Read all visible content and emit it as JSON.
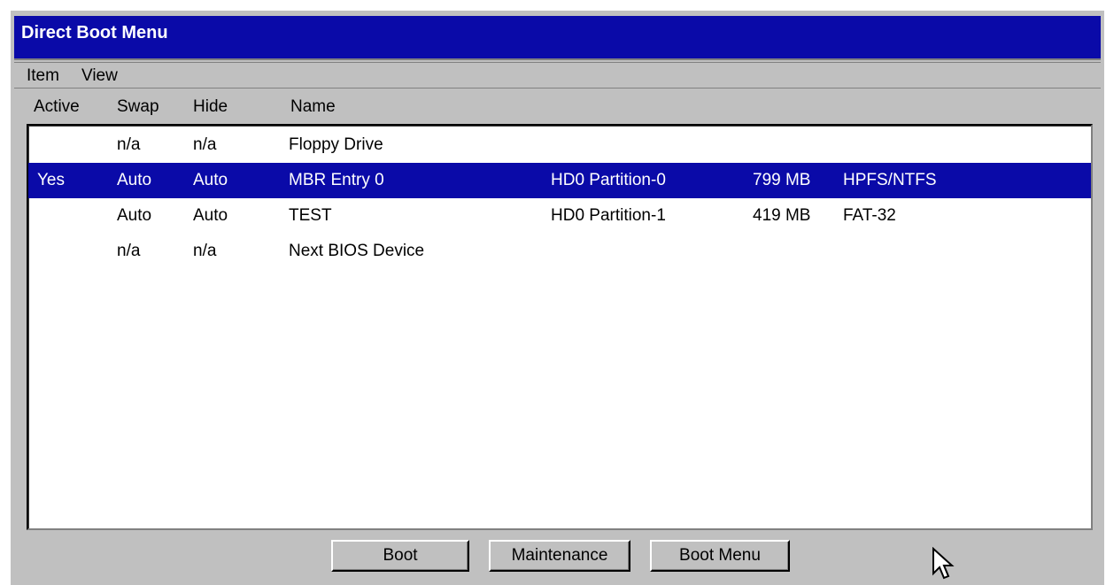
{
  "window": {
    "title": "Direct Boot Menu"
  },
  "menu": {
    "item": "Item",
    "view": "View"
  },
  "columns": {
    "active": "Active",
    "swap": "Swap",
    "hide": "Hide",
    "name": "Name"
  },
  "rows": [
    {
      "active": "",
      "swap": "n/a",
      "hide": "n/a",
      "name": "Floppy Drive",
      "location": "",
      "size": "",
      "fs": "",
      "selected": false
    },
    {
      "active": "Yes",
      "swap": "Auto",
      "hide": "Auto",
      "name": "MBR Entry 0",
      "location": "HD0 Partition-0",
      "size": "799 MB",
      "fs": "HPFS/NTFS",
      "selected": true
    },
    {
      "active": "",
      "swap": "Auto",
      "hide": "Auto",
      "name": "TEST",
      "location": "HD0 Partition-1",
      "size": "419 MB",
      "fs": "FAT-32",
      "selected": false
    },
    {
      "active": "",
      "swap": "n/a",
      "hide": "n/a",
      "name": "Next BIOS Device",
      "location": "",
      "size": "",
      "fs": "",
      "selected": false
    }
  ],
  "buttons": {
    "boot": "Boot",
    "maintenance": "Maintenance",
    "boot_menu": "Boot Menu"
  },
  "colors": {
    "titlebar": "#0a0aa8",
    "selection": "#0a0aa8",
    "face": "#c0c0c0"
  }
}
